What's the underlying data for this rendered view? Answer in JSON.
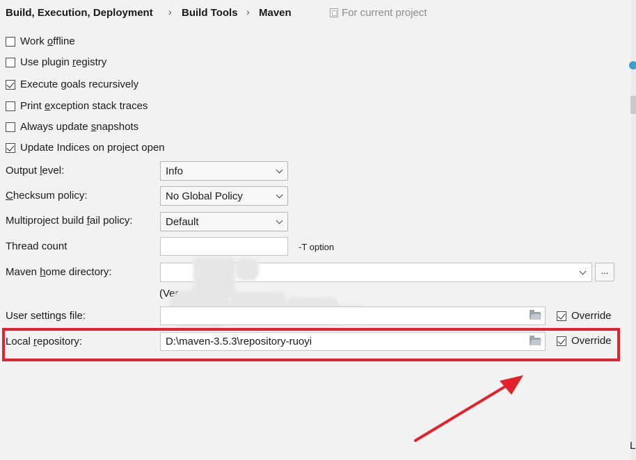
{
  "breadcrumb": {
    "items": [
      "Build, Execution, Deployment",
      "Build Tools",
      "Maven"
    ],
    "separator": "›",
    "scope": "For current project"
  },
  "checkboxes": {
    "work_offline": {
      "pre": "Work ",
      "mnemonic": "o",
      "post": "ffline",
      "checked": false
    },
    "use_plugin_registry": {
      "pre": "Use plugin ",
      "mnemonic": "r",
      "post": "egistry",
      "checked": false
    },
    "execute_goals": {
      "pre": "Execute ",
      "mnemonic": "g",
      "post": "oals recursively",
      "checked": true
    },
    "print_exception": {
      "pre": "Print ",
      "mnemonic": "e",
      "post": "xception stack traces",
      "checked": false
    },
    "always_update": {
      "pre": "Always update ",
      "mnemonic": "s",
      "post": "napshots",
      "checked": false
    },
    "update_indices": {
      "label": "Update Indices on project open",
      "checked": true
    }
  },
  "form": {
    "output_level": {
      "pre": "Output ",
      "mnemonic": "l",
      "post": "evel:",
      "value": "Info"
    },
    "checksum_policy": {
      "pre": "",
      "mnemonic": "C",
      "post": "hecksum policy:",
      "value": "No Global Policy"
    },
    "multiproject": {
      "pre": "Multiproject build ",
      "mnemonic": "f",
      "post": "ail policy:",
      "value": "Default"
    },
    "thread_count": {
      "label": "Thread count",
      "value": "",
      "suffix": "-T option"
    },
    "maven_home": {
      "pre": "Maven ",
      "mnemonic": "h",
      "post": "ome directory:",
      "value": "",
      "browse": "...",
      "version_text": "(Ver"
    },
    "user_settings": {
      "label": "User settings file:",
      "value": "",
      "override_label": "Override",
      "override_checked": true
    },
    "local_repository": {
      "pre": "Local ",
      "mnemonic": "r",
      "post": "epository:",
      "value": "D:\\maven-3.5.3\\repository-ruoyi",
      "override_label": "Override",
      "override_checked": true
    }
  },
  "annotation": {
    "color": "#e3232b"
  },
  "edge": {
    "letter": "L"
  }
}
